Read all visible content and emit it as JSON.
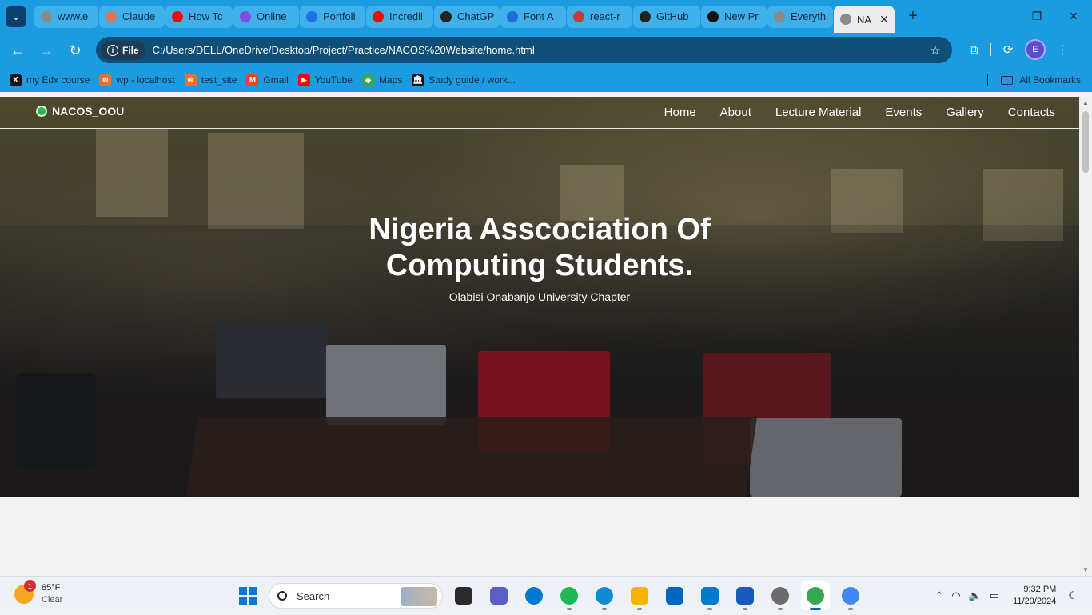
{
  "browser": {
    "tabs": [
      {
        "label": "www.e",
        "color": "#8a8a8a"
      },
      {
        "label": "Claude",
        "color": "#d97757"
      },
      {
        "label": "How Tc",
        "color": "#ff0000"
      },
      {
        "label": "Online",
        "color": "#7b4fe0"
      },
      {
        "label": "Portfoli",
        "color": "#1f6feb"
      },
      {
        "label": "Incredil",
        "color": "#ff0000"
      },
      {
        "label": "ChatGP",
        "color": "#222222"
      },
      {
        "label": "Font A",
        "color": "#1c6dd0"
      },
      {
        "label": "react-r",
        "color": "#cb3837"
      },
      {
        "label": "GitHub",
        "color": "#222222"
      },
      {
        "label": "New Pr",
        "color": "#111111"
      },
      {
        "label": "Everyth",
        "color": "#8a8a8a"
      },
      {
        "label": "NA",
        "color": "#8a8a8a"
      }
    ],
    "window_controls": {
      "minimize": "—",
      "restore": "❐",
      "close": "✕"
    },
    "address": {
      "scheme_chip": "File",
      "url": "C:/Users/DELL/OneDrive/Desktop/Project/Practice/NACOS%20Website/home.html"
    },
    "profile_initial": "E",
    "bookmarks": [
      {
        "label": "my Edx course",
        "icon_text": "X",
        "color": "#111111"
      },
      {
        "label": "wp - localhost",
        "icon_text": "⊗",
        "color": "#f36f21"
      },
      {
        "label": "test_site",
        "icon_text": "⊗",
        "color": "#f36f21"
      },
      {
        "label": "Gmail",
        "icon_text": "M",
        "color": "#ea4335"
      },
      {
        "label": "YouTube",
        "icon_text": "▶",
        "color": "#ff0000"
      },
      {
        "label": "Maps",
        "icon_text": "◆",
        "color": "#34a853"
      },
      {
        "label": "Study guide / work...",
        "icon_text": "🏛",
        "color": "#111111"
      }
    ],
    "all_bookmarks": "All Bookmarks"
  },
  "site": {
    "brand": "NACOS_OOU",
    "nav": [
      "Home",
      "About",
      "Lecture Material",
      "Events",
      "Gallery",
      "Contacts"
    ],
    "hero_title_line1": "Nigeria Asscociation Of",
    "hero_title_line2": "Computing Students.",
    "hero_subtitle": "Olabisi Onabanjo University Chapter"
  },
  "taskbar": {
    "weather_temp": "85°F",
    "weather_desc": "Clear",
    "weather_badge": "1",
    "search_placeholder": "Search",
    "apps": [
      {
        "name": "task-view",
        "color": "#2b2b2b"
      },
      {
        "name": "teams",
        "color": "#5b5fc7"
      },
      {
        "name": "skype",
        "color": "#0078d4"
      },
      {
        "name": "spotify",
        "color": "#1db954"
      },
      {
        "name": "edge",
        "color": "#0f8bd6"
      },
      {
        "name": "file-explorer",
        "color": "#f4b400"
      },
      {
        "name": "microsoft-store",
        "color": "#0067c0"
      },
      {
        "name": "vscode",
        "color": "#007acc"
      },
      {
        "name": "word",
        "color": "#185abd"
      },
      {
        "name": "settings",
        "color": "#6b6b6b"
      },
      {
        "name": "chrome",
        "color": "#34a853"
      },
      {
        "name": "chrome-profile",
        "color": "#4285f4"
      }
    ],
    "time": "9:32 PM",
    "date": "11/20/2024"
  }
}
